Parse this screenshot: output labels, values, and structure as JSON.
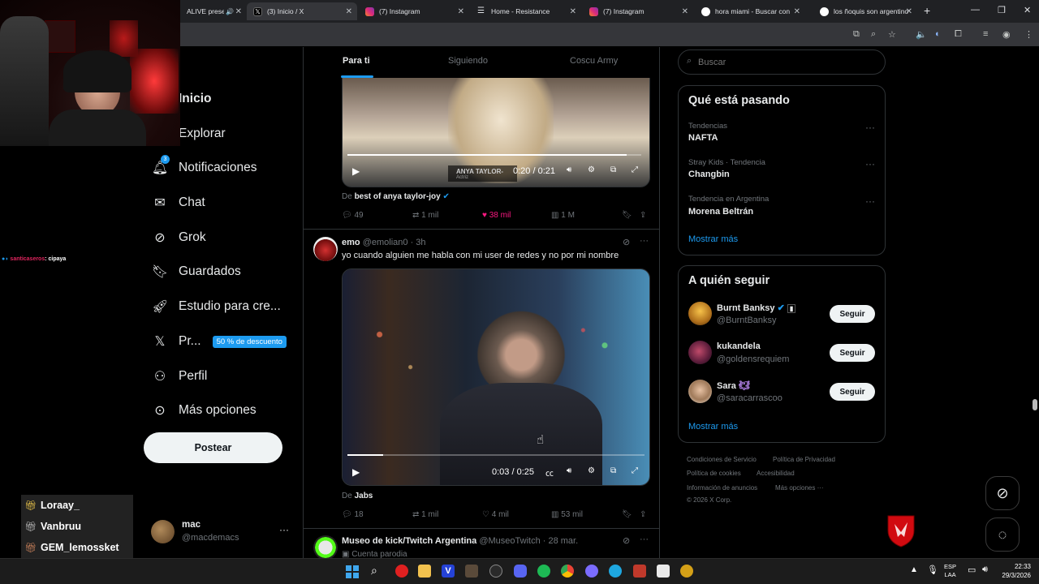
{
  "browser": {
    "tabs": [
      {
        "label": "ALIVE prese",
        "color": "#f4b400"
      },
      {
        "label": "(3) Inicio / X",
        "color": "#ffffff"
      },
      {
        "label": "(7) Instagram",
        "color": "#e1306c"
      },
      {
        "label": "Home - Resistance",
        "color": "#9aa0a6"
      },
      {
        "label": "(7) Instagram",
        "color": "#e1306c"
      },
      {
        "label": "hora miami - Buscar con",
        "color": "#4285f4"
      },
      {
        "label": "los ñoquis son argentino",
        "color": "#4285f4"
      }
    ],
    "new_tab": "+"
  },
  "feed_tabs": [
    "Para ti",
    "Siguiendo",
    "Coscu Army"
  ],
  "sidebar": {
    "items": [
      {
        "label": "Inicio",
        "icon": "home-icon"
      },
      {
        "label": "Explorar",
        "icon": "search-icon"
      },
      {
        "label": "Notificaciones",
        "icon": "bell-icon"
      },
      {
        "label": "Chat",
        "icon": "mail-icon"
      },
      {
        "label": "Grok",
        "icon": "grok-icon"
      },
      {
        "label": "Guardados",
        "icon": "bookmark-icon"
      },
      {
        "label": "Estudio para cre...",
        "icon": "rocket-icon"
      },
      {
        "label": "Pr...",
        "icon": "x-logo-icon"
      },
      {
        "label": "Perfil",
        "icon": "person-icon"
      },
      {
        "label": "Más opciones",
        "icon": "more-circle-icon"
      }
    ],
    "premium_badge": "50 % de descuento",
    "notif_count": "3",
    "post_button": "Postear",
    "account": {
      "name": "mac",
      "handle": "@macdemacs"
    }
  },
  "posts": [
    {
      "video_time": "0:20 / 0:21",
      "video_overlay_text": "ANYA TAYLOR-",
      "video_overlay_sub": "Actriz",
      "source_prefix": "De",
      "source_name": "best of anya taylor-joy",
      "replies": "49",
      "reposts": "1 mil",
      "likes": "38 mil",
      "views": "1 M",
      "progress": 0.95
    },
    {
      "name": "emo",
      "handle": "@emolian0",
      "time": "· 3h",
      "text": "yo cuando alguien me habla con mi user de redes y no por mi nombre",
      "video_time": "0:03 / 0:25",
      "source_prefix": "De",
      "source_name": "Jabs",
      "replies": "18",
      "reposts": "1 mil",
      "likes": "4 mil",
      "views": "53 mil",
      "progress": 0.12
    },
    {
      "name": "Museo de kick/Twitch Argentina",
      "handle": "@MuseoTwitch",
      "time": "· 28 mar.",
      "subtitle": "Cuenta parodia"
    }
  ],
  "search": {
    "placeholder": "Buscar"
  },
  "trends": {
    "title": "Qué está pasando",
    "items": [
      {
        "category": "Tendencias",
        "name": "NAFTA"
      },
      {
        "category": "Stray Kids · Tendencia",
        "name": "Changbin"
      },
      {
        "category": "Tendencia en Argentina",
        "name": "Morena Beltrán"
      }
    ],
    "more": "Mostrar más"
  },
  "who_to_follow": {
    "title": "A quién seguir",
    "users": [
      {
        "name": "Burnt Banksy",
        "handle": "@BurntBanksy",
        "button": "Seguir"
      },
      {
        "name": "kukandela",
        "handle": "@goldensrequiem",
        "button": "Seguir"
      },
      {
        "name": "Sara",
        "handle": "@saracarrascoo",
        "button": "Seguir"
      }
    ],
    "more": "Mostrar más"
  },
  "footer": {
    "links": [
      "Condiciones de Servicio",
      "Política de Privacidad",
      "Política de cookies",
      "Accesibilidad",
      "Información de anuncios",
      "Más opciones ···"
    ],
    "copyright": "© 2026 X Corp."
  },
  "stream_chat": {
    "message_user": "santicaseros",
    "message_text": ": cipaya",
    "viewers": [
      "Loraay_",
      "Vanbruu",
      "GEM_lemossket"
    ]
  },
  "taskbar": {
    "lang_top": "ESP",
    "lang_bottom": "LAA",
    "time": "22:33",
    "date": "29/3/2026"
  }
}
